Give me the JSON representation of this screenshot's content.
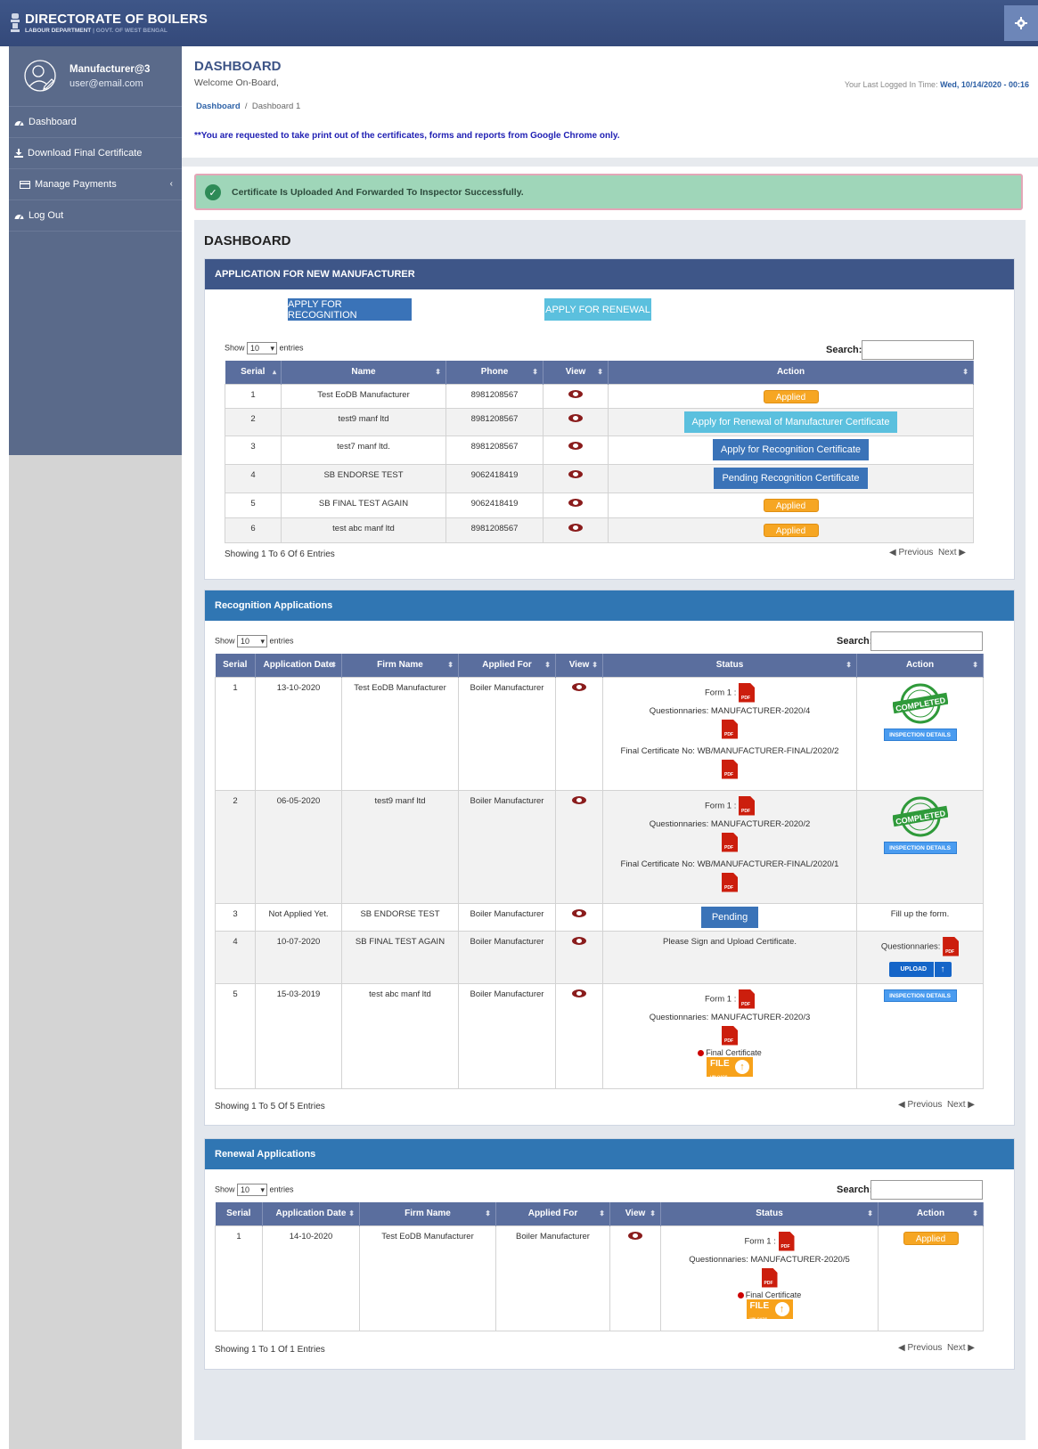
{
  "header": {
    "brand_title": "DIRECTORATE OF BOILERS",
    "brand_sub_1": "LABOUR DEPARTMENT",
    "brand_sub_2": "| GOVT. OF WEST BENGAL"
  },
  "sidebar": {
    "user_name": "Manufacturer@3",
    "user_email": "user@email.com",
    "items": [
      {
        "label": "Dashboard",
        "icon": "dashboard-icon"
      },
      {
        "label": "Download Final Certificate",
        "icon": "download-icon"
      },
      {
        "label": "Manage Payments",
        "icon": "credit-card-icon"
      },
      {
        "label": "Log Out",
        "icon": "dashboard-icon"
      }
    ]
  },
  "page": {
    "title": "DASHBOARD",
    "welcome": "Welcome On-Board,",
    "crumb_home": "Dashboard",
    "crumb_sep": "/",
    "crumb_current": "Dashboard 1",
    "last_login_label": "Your Last Logged In Time:",
    "last_login_value": "Wed, 10/14/2020 - 00:16",
    "notice": "**You are requested to take print out of the certificates, forms and reports from Google Chrome only.",
    "alert": "Certificate Is Uploaded And Forwarded To Inspector Successfully.",
    "dash_title": "DASHBOARD"
  },
  "common": {
    "show": "Show",
    "entries": "entries",
    "page_size": "10",
    "search": "Search:",
    "previous": "Previous",
    "next": "Next",
    "form1": "Form 1 :",
    "final_cert": "Final Certificate",
    "file": "FILE",
    "upload_small": "UPLOADS",
    "applied": "Applied",
    "inspection": "INSPECTION DETAILS",
    "upload": "UPLOAD",
    "stamp_text": "COMPLETED"
  },
  "panel_new": {
    "title": "APPLICATION FOR NEW MANUFACTURER",
    "btn_recognition": "APPLY FOR RECOGNITION",
    "btn_renewal": "APPLY FOR RENEWAL",
    "columns": [
      "Serial",
      "Name",
      "Phone",
      "View",
      "Action"
    ],
    "rows": [
      {
        "serial": "1",
        "name": "Test EoDB Manufacturer",
        "phone": "8981208567",
        "action": "Applied"
      },
      {
        "serial": "2",
        "name": "test9 manf ltd",
        "phone": "8981208567",
        "action": "Apply for Renewal of Manufacturer Certificate"
      },
      {
        "serial": "3",
        "name": "test7 manf ltd.",
        "phone": "8981208567",
        "action": "Apply for Recognition Certificate"
      },
      {
        "serial": "4",
        "name": "SB ENDORSE TEST",
        "phone": "9062418419",
        "action": "Pending Recognition Certificate"
      },
      {
        "serial": "5",
        "name": "SB FINAL TEST AGAIN",
        "phone": "9062418419",
        "action": "Applied"
      },
      {
        "serial": "6",
        "name": "test abc manf ltd",
        "phone": "8981208567",
        "action": "Applied"
      }
    ],
    "showing": "Showing 1 To 6 Of 6 Entries"
  },
  "panel_recog": {
    "title": "Recognition Applications",
    "columns": [
      "Serial",
      "Application Date",
      "Firm Name",
      "Applied For",
      "View",
      "Status",
      "Action"
    ],
    "rows": [
      {
        "serial": "1",
        "date": "13-10-2020",
        "firm": "Test EoDB Manufacturer",
        "applied_for": "Boiler Manufacturer",
        "questionnaire": "Questionnaries: MANUFACTURER-2020/4",
        "final_no": "Final Certificate No: WB/MANUFACTURER-FINAL/2020/2"
      },
      {
        "serial": "2",
        "date": "06-05-2020",
        "firm": "test9 manf ltd",
        "applied_for": "Boiler Manufacturer",
        "questionnaire": "Questionnaries: MANUFACTURER-2020/2",
        "final_no": "Final Certificate No: WB/MANUFACTURER-FINAL/2020/1"
      },
      {
        "serial": "3",
        "date": "Not Applied Yet.",
        "firm": "SB ENDORSE TEST",
        "applied_for": "Boiler Manufacturer",
        "status_btn": "Pending",
        "action_text": "Fill up the form."
      },
      {
        "serial": "4",
        "date": "10-07-2020",
        "firm": "SB FINAL TEST AGAIN",
        "applied_for": "Boiler Manufacturer",
        "status_text": "Please Sign and Upload Certificate.",
        "action_label": "Questionnaries:"
      },
      {
        "serial": "5",
        "date": "15-03-2019",
        "firm": "test abc manf ltd",
        "applied_for": "Boiler Manufacturer",
        "questionnaire": "Questionnaries: MANUFACTURER-2020/3"
      }
    ],
    "showing": "Showing 1 To 5 Of 5 Entries"
  },
  "panel_renew": {
    "title": "Renewal Applications",
    "columns": [
      "Serial",
      "Application Date",
      "Firm Name",
      "Applied For",
      "View",
      "Status",
      "Action"
    ],
    "rows": [
      {
        "serial": "1",
        "date": "14-10-2020",
        "firm": "Test EoDB Manufacturer",
        "applied_for": "Boiler Manufacturer",
        "questionnaire": "Questionnaries: MANUFACTURER-2020/5",
        "action": "Applied"
      }
    ],
    "showing": "Showing 1 To 1 Of 1 Entries"
  },
  "colors": {
    "header": "#3e5688",
    "sidebar": "#5a6a8a",
    "panel_blue": "#3076b3",
    "btn_primary": "#3a73b8",
    "btn_info": "#5bc0de",
    "applied": "#f6a623"
  }
}
